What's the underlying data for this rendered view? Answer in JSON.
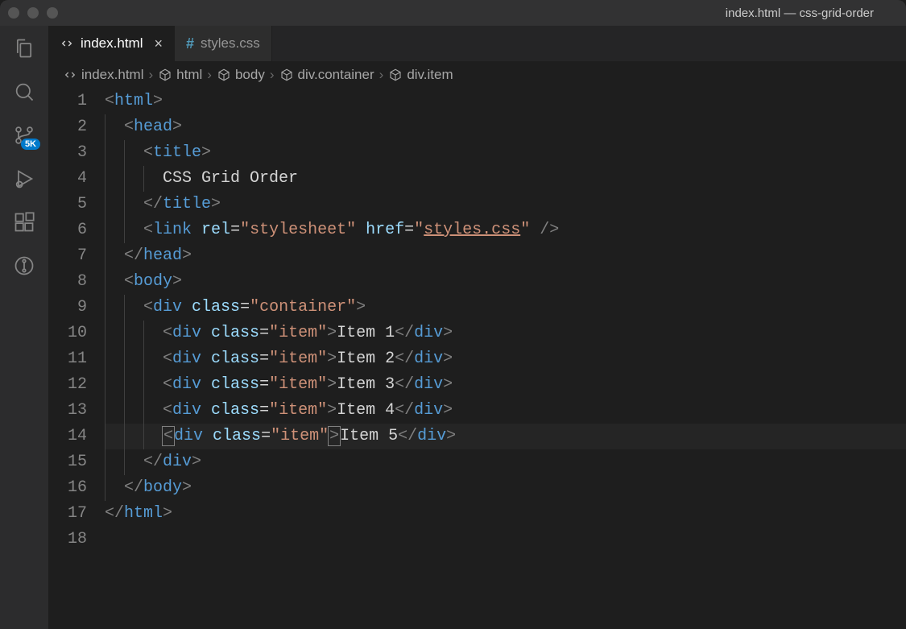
{
  "window_title": "index.html — css-grid-order",
  "activitybar": {
    "items": [
      {
        "name": "explorer-icon"
      },
      {
        "name": "search-icon"
      },
      {
        "name": "source-control-icon",
        "badge": "5K"
      },
      {
        "name": "run-debug-icon"
      },
      {
        "name": "extensions-icon"
      },
      {
        "name": "git-graph-icon"
      }
    ]
  },
  "tabs": [
    {
      "label": "index.html",
      "type": "html",
      "active": true,
      "closeable": true
    },
    {
      "label": "styles.css",
      "type": "css",
      "active": false
    }
  ],
  "breadcrumbs": [
    {
      "icon": "code",
      "label": "index.html"
    },
    {
      "icon": "cube",
      "label": "html"
    },
    {
      "icon": "cube",
      "label": "body"
    },
    {
      "icon": "cube",
      "label": "div.container"
    },
    {
      "icon": "cube",
      "label": "div.item"
    }
  ],
  "gutter_start": 1,
  "gutter_end": 18,
  "highlight_line": 14,
  "code_lines": [
    {
      "indent": 0,
      "tokens": [
        {
          "t": "<",
          "c": "brkt"
        },
        {
          "t": "html",
          "c": "tag"
        },
        {
          "t": ">",
          "c": "brkt"
        }
      ]
    },
    {
      "indent": 1,
      "tokens": [
        {
          "t": "<",
          "c": "brkt"
        },
        {
          "t": "head",
          "c": "tag"
        },
        {
          "t": ">",
          "c": "brkt"
        }
      ]
    },
    {
      "indent": 2,
      "tokens": [
        {
          "t": "<",
          "c": "brkt"
        },
        {
          "t": "title",
          "c": "tag"
        },
        {
          "t": ">",
          "c": "brkt"
        }
      ]
    },
    {
      "indent": 3,
      "tokens": [
        {
          "t": "CSS Grid Order",
          "c": "text"
        }
      ]
    },
    {
      "indent": 2,
      "tokens": [
        {
          "t": "</",
          "c": "brkt"
        },
        {
          "t": "title",
          "c": "tag"
        },
        {
          "t": ">",
          "c": "brkt"
        }
      ]
    },
    {
      "indent": 2,
      "tokens": [
        {
          "t": "<",
          "c": "brkt"
        },
        {
          "t": "link",
          "c": "tag"
        },
        {
          "t": " ",
          "c": "text"
        },
        {
          "t": "rel",
          "c": "attr"
        },
        {
          "t": "=",
          "c": "text"
        },
        {
          "t": "\"stylesheet\"",
          "c": "str"
        },
        {
          "t": " ",
          "c": "text"
        },
        {
          "t": "href",
          "c": "attr"
        },
        {
          "t": "=",
          "c": "text"
        },
        {
          "t": "\"",
          "c": "str"
        },
        {
          "t": "styles.css",
          "c": "link"
        },
        {
          "t": "\"",
          "c": "str"
        },
        {
          "t": " />",
          "c": "brkt"
        }
      ]
    },
    {
      "indent": 1,
      "tokens": [
        {
          "t": "</",
          "c": "brkt"
        },
        {
          "t": "head",
          "c": "tag"
        },
        {
          "t": ">",
          "c": "brkt"
        }
      ]
    },
    {
      "indent": 1,
      "tokens": [
        {
          "t": "<",
          "c": "brkt"
        },
        {
          "t": "body",
          "c": "tag"
        },
        {
          "t": ">",
          "c": "brkt"
        }
      ]
    },
    {
      "indent": 2,
      "tokens": [
        {
          "t": "<",
          "c": "brkt"
        },
        {
          "t": "div",
          "c": "tag"
        },
        {
          "t": " ",
          "c": "text"
        },
        {
          "t": "class",
          "c": "attr"
        },
        {
          "t": "=",
          "c": "text"
        },
        {
          "t": "\"container\"",
          "c": "str"
        },
        {
          "t": ">",
          "c": "brkt"
        }
      ]
    },
    {
      "indent": 3,
      "tokens": [
        {
          "t": "<",
          "c": "brkt"
        },
        {
          "t": "div",
          "c": "tag"
        },
        {
          "t": " ",
          "c": "text"
        },
        {
          "t": "class",
          "c": "attr"
        },
        {
          "t": "=",
          "c": "text"
        },
        {
          "t": "\"item\"",
          "c": "str"
        },
        {
          "t": ">",
          "c": "brkt"
        },
        {
          "t": "Item 1",
          "c": "text"
        },
        {
          "t": "</",
          "c": "brkt"
        },
        {
          "t": "div",
          "c": "tag"
        },
        {
          "t": ">",
          "c": "brkt"
        }
      ]
    },
    {
      "indent": 3,
      "tokens": [
        {
          "t": "<",
          "c": "brkt"
        },
        {
          "t": "div",
          "c": "tag"
        },
        {
          "t": " ",
          "c": "text"
        },
        {
          "t": "class",
          "c": "attr"
        },
        {
          "t": "=",
          "c": "text"
        },
        {
          "t": "\"item\"",
          "c": "str"
        },
        {
          "t": ">",
          "c": "brkt"
        },
        {
          "t": "Item 2",
          "c": "text"
        },
        {
          "t": "</",
          "c": "brkt"
        },
        {
          "t": "div",
          "c": "tag"
        },
        {
          "t": ">",
          "c": "brkt"
        }
      ]
    },
    {
      "indent": 3,
      "tokens": [
        {
          "t": "<",
          "c": "brkt"
        },
        {
          "t": "div",
          "c": "tag"
        },
        {
          "t": " ",
          "c": "text"
        },
        {
          "t": "class",
          "c": "attr"
        },
        {
          "t": "=",
          "c": "text"
        },
        {
          "t": "\"item\"",
          "c": "str"
        },
        {
          "t": ">",
          "c": "brkt"
        },
        {
          "t": "Item 3",
          "c": "text"
        },
        {
          "t": "</",
          "c": "brkt"
        },
        {
          "t": "div",
          "c": "tag"
        },
        {
          "t": ">",
          "c": "brkt"
        }
      ]
    },
    {
      "indent": 3,
      "tokens": [
        {
          "t": "<",
          "c": "brkt"
        },
        {
          "t": "div",
          "c": "tag"
        },
        {
          "t": " ",
          "c": "text"
        },
        {
          "t": "class",
          "c": "attr"
        },
        {
          "t": "=",
          "c": "text"
        },
        {
          "t": "\"item\"",
          "c": "str"
        },
        {
          "t": ">",
          "c": "brkt"
        },
        {
          "t": "Item 4",
          "c": "text"
        },
        {
          "t": "</",
          "c": "brkt"
        },
        {
          "t": "div",
          "c": "tag"
        },
        {
          "t": ">",
          "c": "brkt"
        }
      ]
    },
    {
      "indent": 3,
      "tokens": [
        {
          "t": "<",
          "c": "brkt",
          "box": true
        },
        {
          "t": "div",
          "c": "tag"
        },
        {
          "t": " ",
          "c": "text"
        },
        {
          "t": "class",
          "c": "attr"
        },
        {
          "t": "=",
          "c": "text"
        },
        {
          "t": "\"item\"",
          "c": "str"
        },
        {
          "t": ">",
          "c": "brkt",
          "box": true
        },
        {
          "t": "Item 5",
          "c": "text"
        },
        {
          "t": "</",
          "c": "brkt"
        },
        {
          "t": "div",
          "c": "tag"
        },
        {
          "t": ">",
          "c": "brkt"
        }
      ]
    },
    {
      "indent": 2,
      "tokens": [
        {
          "t": "</",
          "c": "brkt"
        },
        {
          "t": "div",
          "c": "tag"
        },
        {
          "t": ">",
          "c": "brkt"
        }
      ]
    },
    {
      "indent": 1,
      "tokens": [
        {
          "t": "</",
          "c": "brkt"
        },
        {
          "t": "body",
          "c": "tag"
        },
        {
          "t": ">",
          "c": "brkt"
        }
      ]
    },
    {
      "indent": 0,
      "tokens": [
        {
          "t": "</",
          "c": "brkt"
        },
        {
          "t": "html",
          "c": "tag"
        },
        {
          "t": ">",
          "c": "brkt"
        }
      ]
    },
    {
      "indent": 0,
      "tokens": []
    }
  ]
}
